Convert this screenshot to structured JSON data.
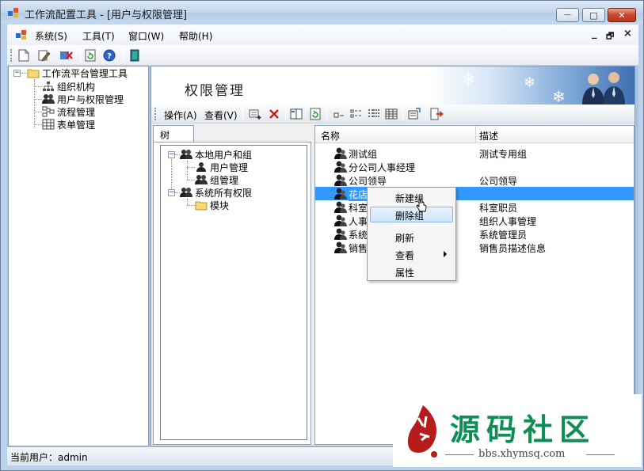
{
  "window": {
    "title": "工作流配置工具 - [用户与权限管理]",
    "controls": {
      "minimize": "—",
      "maximize": "□",
      "close": "✕"
    }
  },
  "menubar": {
    "items": [
      "系统(S)",
      "工具(T)",
      "窗口(W)",
      "帮助(H)"
    ],
    "mdi_controls": {
      "minimize": "_",
      "restore": "🗗",
      "close": "×"
    }
  },
  "toolbar": {
    "icons": [
      "new-document-icon",
      "edit-icon",
      "delete-icon",
      "refresh-icon",
      "help-icon",
      "exit-icon"
    ]
  },
  "left_tree": {
    "root": "工作流平台管理工具",
    "children": [
      "组织机构",
      "用户与权限管理",
      "流程管理",
      "表单管理"
    ]
  },
  "child": {
    "banner_title": "权限管理",
    "toolbar": {
      "menus": [
        "操作(A)",
        "查看(V)"
      ]
    },
    "tab": {
      "label": "树"
    },
    "tree": {
      "local_users_groups": "本地用户和组",
      "user_management": "用户管理",
      "group_management": "组管理",
      "all_permissions": "系统所有权限",
      "modules": "模块"
    },
    "list": {
      "columns": [
        "名称",
        "描述"
      ],
      "rows": [
        {
          "name": "测试组",
          "desc": "测试专用组"
        },
        {
          "name": "分公司人事经理",
          "desc": ""
        },
        {
          "name": "公司领导",
          "desc": "公司领导"
        },
        {
          "name": "花店",
          "desc": ""
        },
        {
          "name": "科室",
          "desc": "科室职员"
        },
        {
          "name": "人事",
          "desc": "组织人事管理"
        },
        {
          "name": "系统",
          "desc": "系统管理员"
        },
        {
          "name": "销售",
          "desc": "销售员描述信息"
        }
      ]
    }
  },
  "context_menu": {
    "items": [
      "新建组",
      "删除组",
      "刷新",
      "查看",
      "属性"
    ]
  },
  "statusbar": {
    "current_user": "当前用户：admin"
  },
  "watermark": {
    "brand": "源码社区",
    "url": "bbs.xhymsq.com",
    "seal": "小猿"
  },
  "colors": {
    "selection": "#3399ff",
    "watermark_green": "#0e8e54",
    "frame": "#b9d1ea"
  }
}
